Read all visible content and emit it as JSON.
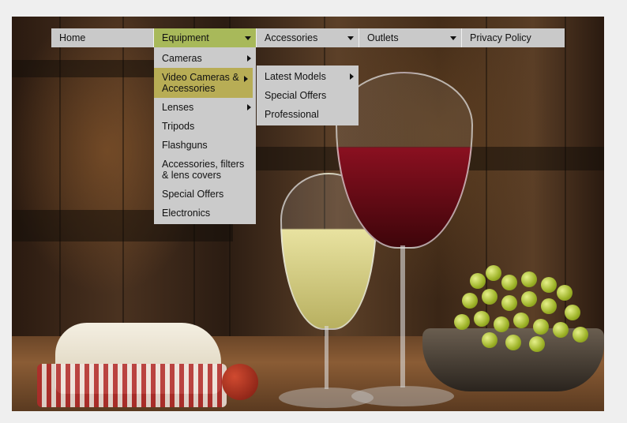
{
  "nav": {
    "items": [
      {
        "label": "Home"
      },
      {
        "label": "Equipment"
      },
      {
        "label": "Accessories"
      },
      {
        "label": "Outlets"
      },
      {
        "label": "Privacy Policy"
      }
    ]
  },
  "equipment_menu": {
    "items": [
      {
        "label": "Cameras"
      },
      {
        "label": "Video Cameras & Accessories"
      },
      {
        "label": "Lenses"
      },
      {
        "label": "Tripods"
      },
      {
        "label": "Flashguns"
      },
      {
        "label": "Accessories, filters & lens covers"
      },
      {
        "label": "Special Offers"
      },
      {
        "label": "Electronics"
      }
    ]
  },
  "video_menu": {
    "items": [
      {
        "label": "Latest Models"
      },
      {
        "label": "Special Offers"
      },
      {
        "label": "Professional"
      }
    ]
  },
  "colors": {
    "menu_bg": "#c9c9c9",
    "active_top": "#a8b95a",
    "active_sub": "#b8ad55"
  }
}
